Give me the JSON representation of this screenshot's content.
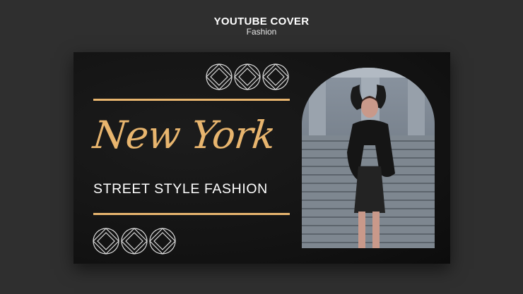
{
  "header": {
    "title": "YOUTUBE COVER",
    "subtitle": "Fashion"
  },
  "cover": {
    "script_title": "New York",
    "tagline": "STREET STYLE FASHION",
    "accent_color": "#e8b56e",
    "background_color": "#121212",
    "ornament": "diamond-in-circle-icon",
    "ornament_count": 3,
    "photo": "woman in black outfit posing on stone stairs"
  }
}
